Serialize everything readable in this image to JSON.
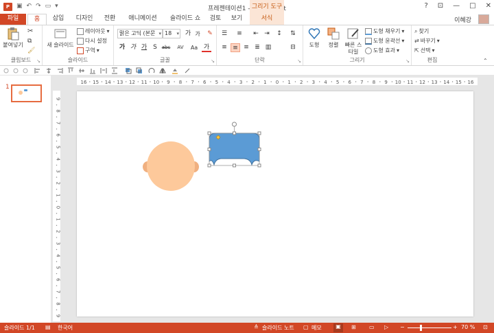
{
  "titlebar": {
    "app_icon": "P",
    "title": "프레젠테이션1 - PowerPoint",
    "contextual_group": "그리기 도구",
    "help": "?",
    "ribbon_display": "⊡",
    "minimize": "—",
    "maximize": "□",
    "close": "✕"
  },
  "tabs": [
    "파일",
    "홈",
    "삽입",
    "디자인",
    "전환",
    "애니메이션",
    "슬라이드 쇼",
    "검토",
    "보기",
    "서식"
  ],
  "user": {
    "name": "이혜강"
  },
  "ribbon": {
    "clipboard": {
      "label": "클립보드",
      "paste": "붙여넣기"
    },
    "slides": {
      "label": "슬라이드",
      "new_slide": "새 슬라이드",
      "layout": "레이아웃",
      "reset": "다시 설정",
      "section": "구역"
    },
    "font": {
      "label": "글꼴",
      "font_name": "맑은 고딕 (본문",
      "font_size": "18",
      "grow": "가",
      "shrink": "가",
      "bold": "가",
      "italic": "가",
      "underline": "가",
      "strikethrough": "S",
      "shadow": "abc",
      "spacing": "AV",
      "case": "Aa",
      "color": "가"
    },
    "paragraph": {
      "label": "단락"
    },
    "drawing": {
      "label": "그리기",
      "shapes": "도형",
      "arrange": "정렬",
      "quick_styles": "빠른 스타일",
      "fill": "도형 채우기",
      "outline": "도형 윤곽선",
      "effects": "도형 효과"
    },
    "editing": {
      "label": "편집",
      "find": "찾기",
      "replace": "바꾸기",
      "select": "선택"
    }
  },
  "slide_pane": {
    "slide_number": "1"
  },
  "ruler": {
    "h_ticks": [
      "16",
      "15",
      "14",
      "13",
      "12",
      "11",
      "10",
      "9",
      "8",
      "7",
      "6",
      "5",
      "4",
      "3",
      "2",
      "1",
      "0",
      "1",
      "2",
      "3",
      "4",
      "5",
      "6",
      "7",
      "8",
      "9",
      "10",
      "11",
      "12",
      "13",
      "14",
      "15",
      "16"
    ],
    "v_ticks": [
      "9",
      "8",
      "7",
      "6",
      "5",
      "4",
      "3",
      "2",
      "1",
      "0",
      "1",
      "2",
      "3",
      "4",
      "5",
      "6",
      "7",
      "8",
      "9"
    ]
  },
  "colors": {
    "accent": "#d24726",
    "face": "#fdc99b",
    "ears": "#f0b080",
    "hair_fill": "#5b9bd5",
    "hair_stroke": "#41719c"
  },
  "status": {
    "slide_info": "슬라이드 1/1",
    "language": "한국어",
    "notes": "슬라이드 노트",
    "comments": "메모",
    "zoom": "70 %",
    "zoom_minus": "−",
    "zoom_plus": "+"
  }
}
